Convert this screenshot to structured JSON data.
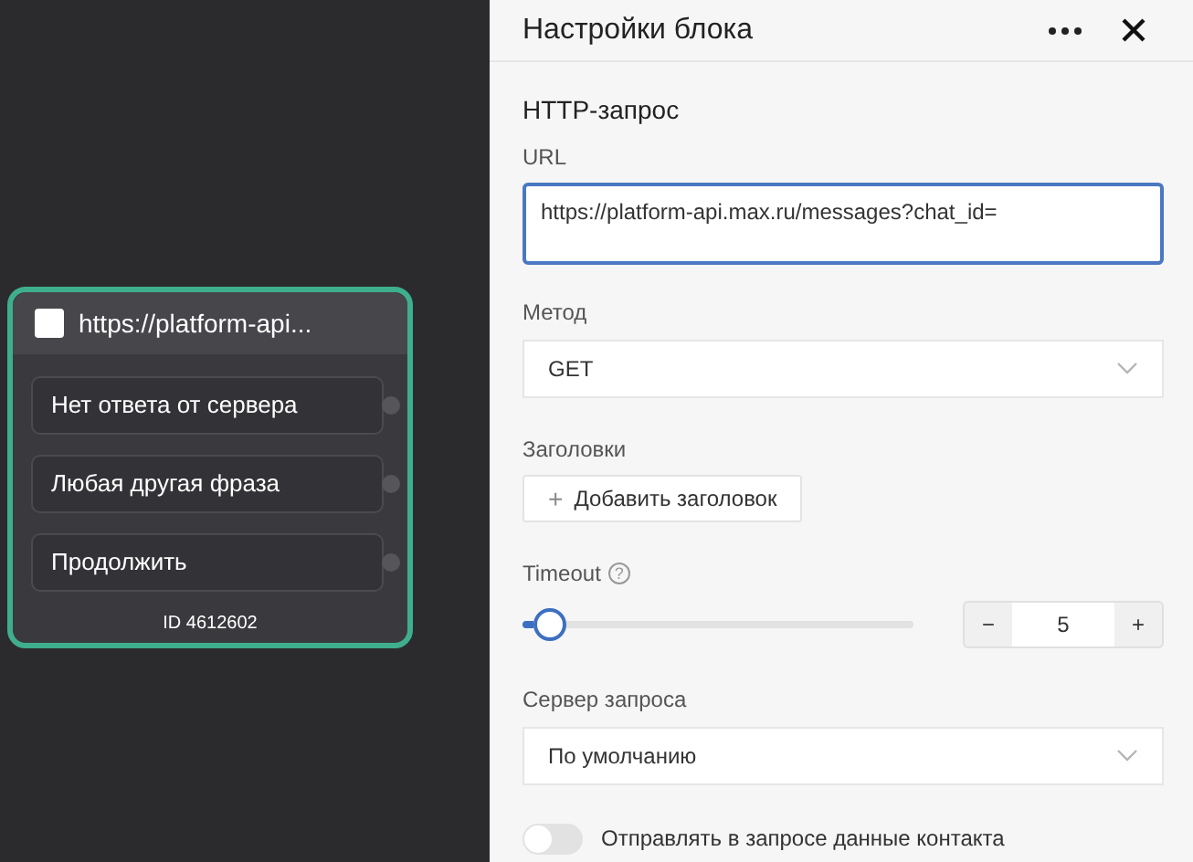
{
  "node": {
    "title": "https://platform-api...",
    "outputs": [
      "Нет ответа от сервера",
      "Любая другая фраза",
      "Продолжить"
    ],
    "id": "ID 4612602"
  },
  "panel": {
    "title": "Настройки блока",
    "section": "HTTP-запрос",
    "url": {
      "label": "URL",
      "value": "https://platform-api.max.ru/messages?chat_id="
    },
    "method": {
      "label": "Метод",
      "value": "GET"
    },
    "headers": {
      "label": "Заголовки",
      "button_icon": "+",
      "button": "Добавить заголовок"
    },
    "timeout": {
      "label": "Timeout",
      "help": "?",
      "level": 0.07,
      "value": "5",
      "minus": "−",
      "plus": "+"
    },
    "server": {
      "label": "Сервер запроса",
      "value": "По умолчанию"
    },
    "send_contact": {
      "label": "Отправлять в запросе данные контакта",
      "on": false
    }
  }
}
